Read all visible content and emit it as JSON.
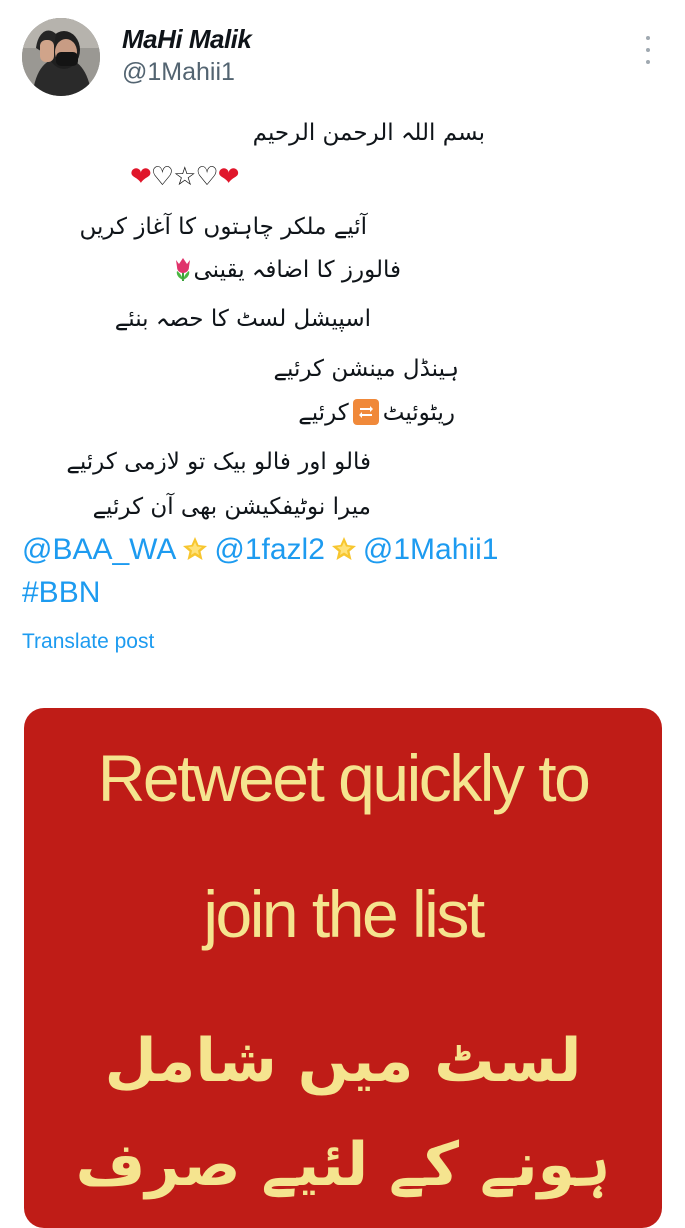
{
  "author": {
    "display_name": "MaHi Malik",
    "handle": "@1Mahii1"
  },
  "post": {
    "lines": [
      "بسم اللہ الرحمن الرحیم",
      "آئیے ملکر چاہتوں کا آغاز کریں",
      "فالورز کا اضافہ یقینی",
      "اسپیشل لسٹ کا حصہ بنئے",
      "ہینڈل مینشن کرئیے",
      "ریٹوئیٹ",
      "کرئیے",
      "فالو اور فالو بیک تو لازمی کرئیے",
      "میرا نوٹیفکیشن بھی آن کرئیے"
    ],
    "hearts": {
      "red": "❤",
      "outline": "♡",
      "star": "☆"
    },
    "mentions": [
      "@BAA_WA",
      "@1fazl2",
      "@1Mahii1"
    ],
    "hashtag": "#BBN",
    "translate_label": "Translate post"
  },
  "media": {
    "line1": "Retweet quickly to",
    "line2": "join the list",
    "urdu1": "لسٹ میں شامل",
    "urdu2": "ہونے کے لئیے صرف"
  },
  "icons": {
    "more": "more-vertical-icon",
    "tulip": "tulip-emoji-icon",
    "retweet": "repeat-emoji-icon",
    "star": "glowing-star-emoji-icon"
  },
  "colors": {
    "link": "#1d9bf0",
    "muted": "#536471",
    "media_bg": "#bf1c17",
    "media_text": "#f5e48f"
  }
}
